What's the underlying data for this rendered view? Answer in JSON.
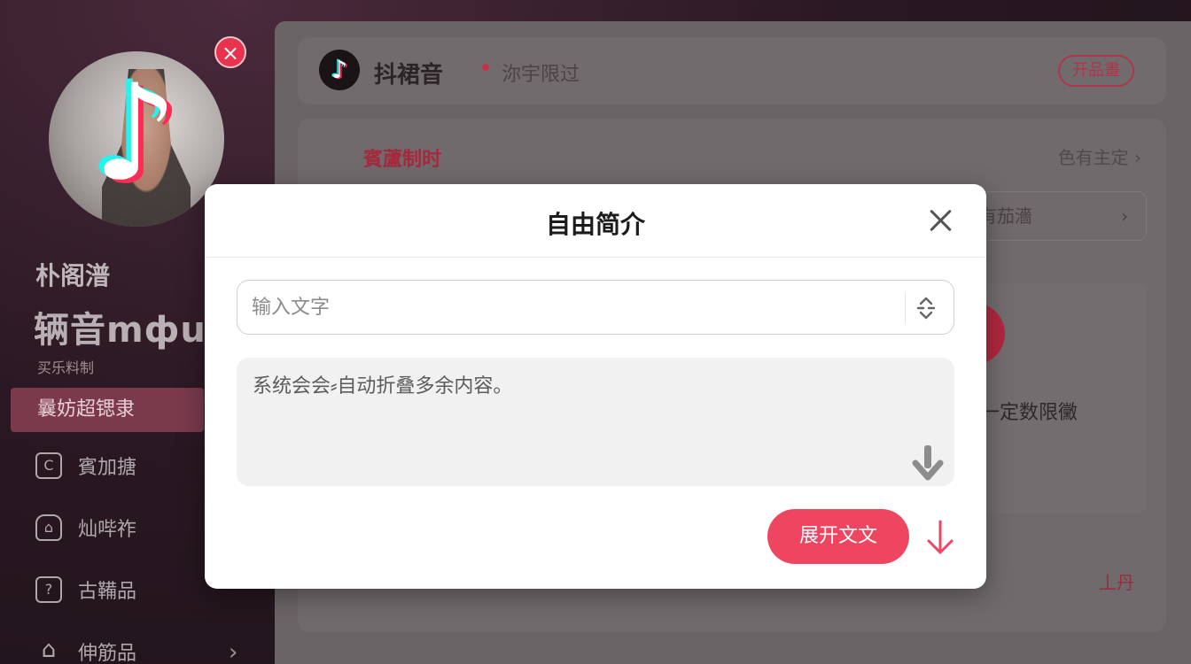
{
  "profile": {
    "name": "朴阁潽",
    "handle": "辆音mфu",
    "subtitle": "买乐料制"
  },
  "sidebar": {
    "active_item": "曩妨超锶隶",
    "items": [
      {
        "icon": "c-square-icon",
        "label": "賓加搪"
      },
      {
        "icon": "home-icon",
        "label": "灿哔祚"
      },
      {
        "icon": "question-square-icon",
        "label": "古鞴品"
      },
      {
        "icon": "house-outline-icon",
        "label": "伸筋品"
      }
    ]
  },
  "header": {
    "app_name": "抖裙音",
    "status": "沵宇限过",
    "action": "开品畫"
  },
  "section": {
    "title": "賓蘆制时",
    "link": "色有主定 ›",
    "row_label": "有茄濇",
    "limit_text": "过一定数限黴",
    "unit_text": "丄丹"
  },
  "modal": {
    "title": "自由简介",
    "input_placeholder": "输入文字",
    "textarea_text": "系统会会⸗自动折叠多余内容。",
    "expand_button": "展开文文"
  },
  "colors": {
    "accent": "#EE4660",
    "tiktok_cyan": "#25F4EE",
    "tiktok_red": "#FE2C55"
  }
}
